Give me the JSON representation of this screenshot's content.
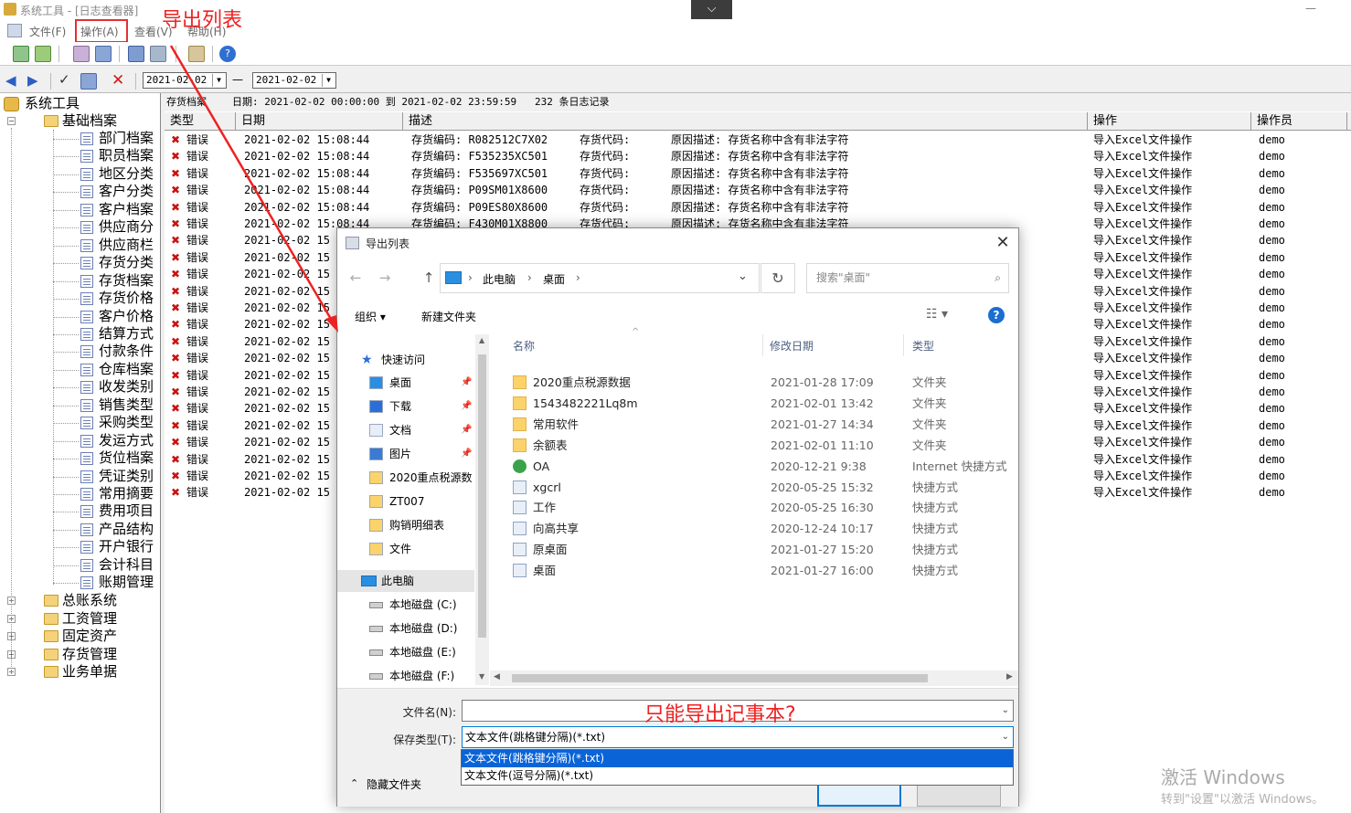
{
  "window": {
    "title": "系统工具 - [日志查看器]"
  },
  "menu": [
    {
      "label": "文件(F)"
    },
    {
      "label": "操作(A)"
    },
    {
      "label": "查看(V)"
    },
    {
      "label": "帮助(H)"
    }
  ],
  "annotations": {
    "export_list": "导出列表",
    "note": "只能导出记事本?"
  },
  "toolbar2": {
    "date_from": "2021-02-02",
    "dash": "—",
    "date_to": "2021-02-02"
  },
  "tree": {
    "root": "系统工具",
    "group": "基础档案",
    "children": [
      "部门档案",
      "职员档案",
      "地区分类",
      "客户分类",
      "客户档案",
      "供应商分",
      "供应商栏",
      "存货分类",
      "存货档案",
      "存货价格",
      "客户价格",
      "结算方式",
      "付款条件",
      "仓库档案",
      "收发类别",
      "销售类型",
      "采购类型",
      "发运方式",
      "货位档案",
      "凭证类别",
      "常用摘要",
      "费用项目",
      "产品结构",
      "开户银行",
      "会计科目",
      "账期管理"
    ],
    "others": [
      "总账系统",
      "工资管理",
      "固定资产",
      "存货管理",
      "业务单据"
    ]
  },
  "grid": {
    "info": {
      "source": "存货档案",
      "date_range": "日期: 2021-02-02 00:00:00 到 2021-02-02 23:59:59",
      "count": "232 条日志记录"
    },
    "columns": [
      "类型",
      "日期",
      "描述",
      "操作",
      "操作员"
    ],
    "full_rows": [
      {
        "type": "错误",
        "date": "2021-02-02 15:08:44",
        "code": "存货编码: R082512C7X02",
        "code2": "存货代码:",
        "reason": "原因描述: 存货名称中含有非法字符",
        "op": "导入Excel文件操作",
        "user": "demo"
      },
      {
        "type": "错误",
        "date": "2021-02-02 15:08:44",
        "code": "存货编码: F535235XC501",
        "code2": "存货代码:",
        "reason": "原因描述: 存货名称中含有非法字符",
        "op": "导入Excel文件操作",
        "user": "demo"
      },
      {
        "type": "错误",
        "date": "2021-02-02 15:08:44",
        "code": "存货编码: F535697XC501",
        "code2": "存货代码:",
        "reason": "原因描述: 存货名称中含有非法字符",
        "op": "导入Excel文件操作",
        "user": "demo"
      },
      {
        "type": "错误",
        "date": "2021-02-02 15:08:44",
        "code": "存货编码: P09SM01X8600",
        "code2": "存货代码:",
        "reason": "原因描述: 存货名称中含有非法字符",
        "op": "导入Excel文件操作",
        "user": "demo"
      },
      {
        "type": "错误",
        "date": "2021-02-02 15:08:44",
        "code": "存货编码: P09ES80X8600",
        "code2": "存货代码:",
        "reason": "原因描述: 存货名称中含有非法字符",
        "op": "导入Excel文件操作",
        "user": "demo"
      },
      {
        "type": "错误",
        "date": "2021-02-02 15:08:44",
        "code": "存货编码: F430M01X8800",
        "code2": "存货代码:",
        "reason": "原因描述: 存货名称中含有非法字符",
        "op": "导入Excel文件操作",
        "user": "demo"
      }
    ],
    "partial_rows": [
      {
        "type": "错误",
        "date": "2021-02-02 15",
        "op": "导入Excel文件操作",
        "user": "demo"
      },
      {
        "type": "错误",
        "date": "2021-02-02 15",
        "op": "导入Excel文件操作",
        "user": "demo"
      },
      {
        "type": "错误",
        "date": "2021-02-02 15",
        "op": "导入Excel文件操作",
        "user": "demo"
      },
      {
        "type": "错误",
        "date": "2021-02-02 15",
        "op": "导入Excel文件操作",
        "user": "demo"
      },
      {
        "type": "错误",
        "date": "2021-02-02 15",
        "op": "导入Excel文件操作",
        "user": "demo"
      },
      {
        "type": "错误",
        "date": "2021-02-02 15",
        "op": "导入Excel文件操作",
        "user": "demo"
      },
      {
        "type": "错误",
        "date": "2021-02-02 15",
        "op": "导入Excel文件操作",
        "user": "demo"
      },
      {
        "type": "错误",
        "date": "2021-02-02 15",
        "op": "导入Excel文件操作",
        "user": "demo"
      },
      {
        "type": "错误",
        "date": "2021-02-02 15",
        "op": "导入Excel文件操作",
        "user": "demo"
      },
      {
        "type": "错误",
        "date": "2021-02-02 15",
        "op": "导入Excel文件操作",
        "user": "demo"
      },
      {
        "type": "错误",
        "date": "2021-02-02 15",
        "op": "导入Excel文件操作",
        "user": "demo"
      },
      {
        "type": "错误",
        "date": "2021-02-02 15",
        "op": "导入Excel文件操作",
        "user": "demo"
      },
      {
        "type": "错误",
        "date": "2021-02-02 15",
        "op": "导入Excel文件操作",
        "user": "demo"
      },
      {
        "type": "错误",
        "date": "2021-02-02 15",
        "op": "导入Excel文件操作",
        "user": "demo"
      },
      {
        "type": "错误",
        "date": "2021-02-02 15",
        "op": "导入Excel文件操作",
        "user": "demo"
      },
      {
        "type": "错误",
        "date": "2021-02-02 15",
        "op": "导入Excel文件操作",
        "user": "demo"
      }
    ]
  },
  "dialog": {
    "title": "导出列表",
    "breadcrumb": [
      "此电脑",
      "桌面"
    ],
    "search_placeholder": "搜索\"桌面\"",
    "organize": "组织 ▾",
    "new_folder": "新建文件夹",
    "nav": {
      "quick_access": "快速访问",
      "quick_items": [
        {
          "label": "桌面",
          "icon": "desktop-icon",
          "pinned": true
        },
        {
          "label": "下载",
          "icon": "download-icon",
          "pinned": true
        },
        {
          "label": "文档",
          "icon": "document-icon",
          "pinned": true
        },
        {
          "label": "图片",
          "icon": "picture-icon",
          "pinned": true
        },
        {
          "label": "2020重点税源数",
          "icon": "folder-icon",
          "pinned": false
        },
        {
          "label": "ZT007",
          "icon": "folder-icon",
          "pinned": false
        },
        {
          "label": "购销明细表",
          "icon": "folder-icon",
          "pinned": false
        },
        {
          "label": "文件",
          "icon": "folder-icon",
          "pinned": false
        }
      ],
      "this_pc": "此电脑",
      "drives": [
        "本地磁盘 (C:)",
        "本地磁盘 (D:)",
        "本地磁盘 (E:)",
        "本地磁盘 (F:)"
      ]
    },
    "columns": [
      "名称",
      "修改日期",
      "类型"
    ],
    "files": [
      {
        "name": "2020重点税源数据",
        "date": "2021-01-28 17:09",
        "type": "文件夹",
        "icon": "folder-icon"
      },
      {
        "name": "1543482221Lq8m",
        "date": "2021-02-01 13:42",
        "type": "文件夹",
        "icon": "folder-icon"
      },
      {
        "name": "常用软件",
        "date": "2021-01-27 14:34",
        "type": "文件夹",
        "icon": "folder-icon"
      },
      {
        "name": "余额表",
        "date": "2021-02-01 11:10",
        "type": "文件夹",
        "icon": "folder-icon"
      },
      {
        "name": "OA",
        "date": "2020-12-21 9:38",
        "type": "Internet 快捷方式",
        "icon": "internet-shortcut-icon"
      },
      {
        "name": "xgcrl",
        "date": "2020-05-25 15:32",
        "type": "快捷方式",
        "icon": "shortcut-icon"
      },
      {
        "name": "工作",
        "date": "2020-05-25 16:30",
        "type": "快捷方式",
        "icon": "shortcut-icon"
      },
      {
        "name": "向高共享",
        "date": "2020-12-24 10:17",
        "type": "快捷方式",
        "icon": "shortcut-icon"
      },
      {
        "name": "原桌面",
        "date": "2021-01-27 15:20",
        "type": "快捷方式",
        "icon": "shortcut-icon"
      },
      {
        "name": "桌面",
        "date": "2021-01-27 16:00",
        "type": "快捷方式",
        "icon": "shortcut-icon"
      }
    ],
    "filename_label": "文件名(N):",
    "filename_value": "",
    "filetype_label": "保存类型(T):",
    "filetype_value": "文本文件(跳格键分隔)(*.txt)",
    "filetype_options": [
      "文本文件(跳格键分隔)(*.txt)",
      "文本文件(逗号分隔)(*.txt)"
    ],
    "hide_folders": "隐藏文件夹"
  },
  "watermark": {
    "line1": "激活 Windows",
    "line2": "转到\"设置\"以激活 Windows。"
  },
  "colors": {
    "accent": "#0078d7",
    "selection": "#0a64d7",
    "annotation": "#ee2222",
    "error": "#cc1111"
  }
}
